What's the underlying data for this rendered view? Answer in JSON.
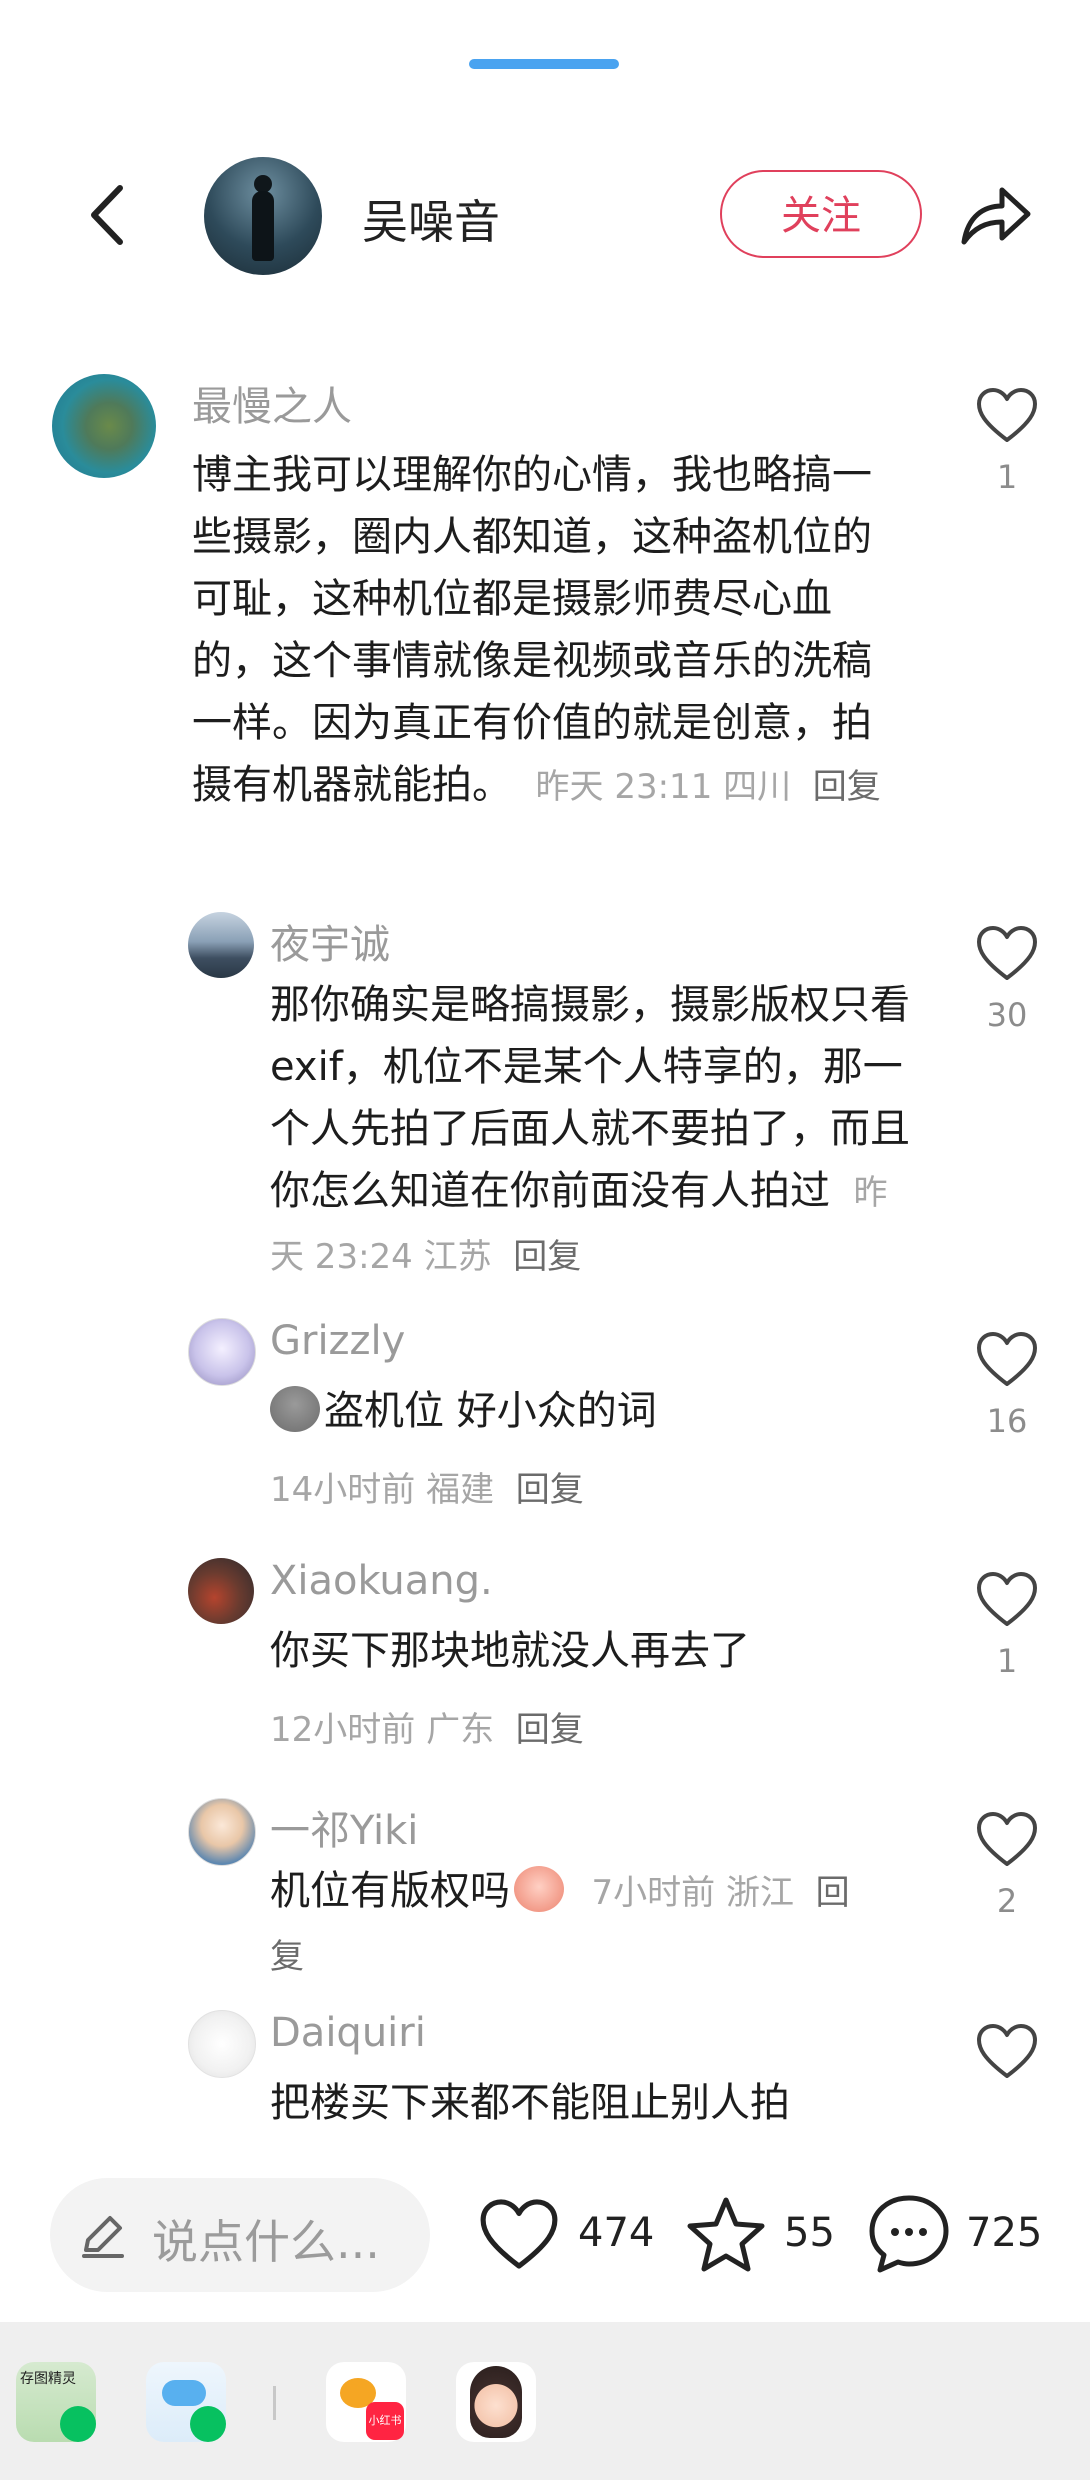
{
  "header": {
    "author_name": "吴噪音",
    "follow_label": "关注"
  },
  "comments": [
    {
      "name": "最慢之人",
      "text": "博主我可以理解你的心情，我也略搞一些摄影，圈内人都知道，这种盗机位的可耻，这种机位都是摄影师费尽心血的，这个事情就像是视频或音乐的洗稿一样。因为真正有价值的就是创意，拍摄有机器就能拍。",
      "time": "昨天 23:11",
      "location": "四川",
      "reply_label": "回复",
      "likes": "1"
    },
    {
      "name": "夜宇诚",
      "text": "那你确实是略搞摄影，摄影版权只看exif，机位不是某个人特享的，那一个人先拍了后面人就不要拍了，而且你怎么知道在你前面没有人拍过",
      "time": "昨天 23:24",
      "location": "江苏",
      "reply_label": "回复",
      "likes": "30"
    },
    {
      "name": "Grizzly",
      "text": "盗机位 好小众的词",
      "time": "14小时前",
      "location": "福建",
      "reply_label": "回复",
      "likes": "16"
    },
    {
      "name": "Xiaokuang.",
      "text": "你买下那块地就没人再去了",
      "time": "12小时前",
      "location": "广东",
      "reply_label": "回复",
      "likes": "1"
    },
    {
      "name": "一祁Yiki",
      "text": "机位有版权吗",
      "time": "7小时前",
      "location": "浙江",
      "reply_label": "回",
      "reply_label_wrap": "复",
      "likes": "2"
    },
    {
      "name": "Daiquiri",
      "text": "把楼买下来都不能阻止别人拍",
      "likes": ""
    }
  ],
  "bottom_bar": {
    "input_placeholder": "说点什么...",
    "likes_count": "474",
    "favorites_count": "55",
    "comments_count": "725"
  },
  "dock": {
    "apps": [
      "存图精灵",
      "小红书"
    ]
  },
  "colors": {
    "accent": "#e0405c",
    "handle": "#4aa3f0",
    "meta_text": "#a6a6a6"
  },
  "icons": [
    "back-arrow-icon",
    "share-icon",
    "heart-icon",
    "pencil-icon",
    "star-icon",
    "comment-bubble-icon"
  ]
}
